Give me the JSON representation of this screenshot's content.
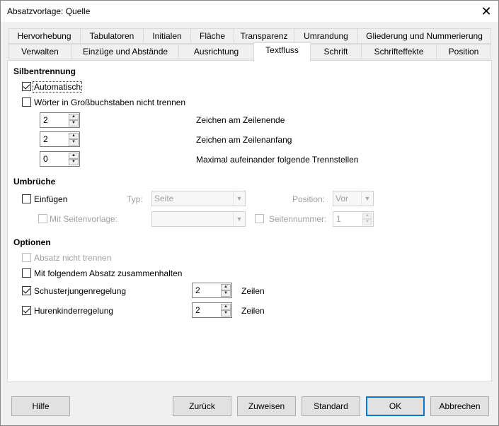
{
  "window": {
    "title": "Absatzvorlage: Quelle",
    "close_glyph": "✕"
  },
  "tabs_row1": [
    "Hervorhebung",
    "Tabulatoren",
    "Initialen",
    "Fläche",
    "Transparenz",
    "Umrandung",
    "Gliederung und Nummerierung"
  ],
  "tabs_row2": [
    "Verwalten",
    "Einzüge und Abstände",
    "Ausrichtung",
    "Textfluss",
    "Schrift",
    "Schrifteffekte",
    "Position"
  ],
  "active_tab": "Textfluss",
  "hyphenation": {
    "heading": "Silbentrennung",
    "auto_label": "Automatisch",
    "auto_checked": true,
    "no_caps_label": "Wörter in Großbuchstaben nicht trennen",
    "no_caps_checked": false,
    "end_value": "2",
    "end_label": "Zeichen am Zeilenende",
    "begin_value": "2",
    "begin_label": "Zeichen am Zeilenanfang",
    "max_value": "0",
    "max_label": "Maximal aufeinander folgende Trennstellen"
  },
  "breaks": {
    "heading": "Umbrüche",
    "insert_label": "Einfügen",
    "insert_checked": false,
    "type_label": "Typ:",
    "type_value": "Seite",
    "position_label": "Position:",
    "position_value": "Vor",
    "pagestyle_label": "Mit Seitenvorlage:",
    "pagestyle_value": "",
    "pagenum_label": "Seitennummer:",
    "pagenum_value": "1"
  },
  "options": {
    "heading": "Optionen",
    "keep_label": "Absatz nicht trennen",
    "keep_checked": false,
    "keep_next_label": "Mit folgendem Absatz zusammenhalten",
    "keep_next_checked": false,
    "orphan_label": "Schusterjungenregelung",
    "orphan_checked": true,
    "orphan_value": "2",
    "orphan_unit": "Zeilen",
    "widow_label": "Hurenkinderregelung",
    "widow_checked": true,
    "widow_value": "2",
    "widow_unit": "Zeilen"
  },
  "buttons": {
    "help": "Hilfe",
    "back": "Zurück",
    "apply": "Zuweisen",
    "standard": "Standard",
    "ok": "OK",
    "cancel": "Abbrechen"
  }
}
